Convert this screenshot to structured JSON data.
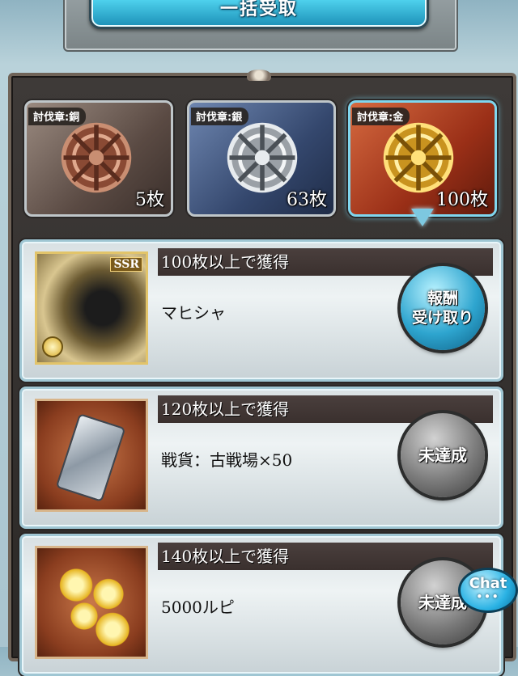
{
  "top_button": {
    "label": "一括受取"
  },
  "medals": [
    {
      "label": "討伐章:銅",
      "count": "5枚",
      "tier": "bronze"
    },
    {
      "label": "討伐章:銀",
      "count": "63枚",
      "tier": "silver"
    },
    {
      "label": "討伐章:金",
      "count": "100枚",
      "tier": "gold",
      "selected": true
    }
  ],
  "rewards": [
    {
      "requirement": "100枚以上で獲得",
      "item": "マヒシャ",
      "rarity_badge": "SSR",
      "button": "報酬\n受け取り",
      "state": "active",
      "icon": "weapon-icon"
    },
    {
      "requirement": "120枚以上で獲得",
      "item": "戦貨：古戦場×50",
      "button": "未達成",
      "state": "inactive",
      "icon": "war-currency-icon"
    },
    {
      "requirement": "140枚以上で獲得",
      "item": "5000ルピ",
      "button": "未達成",
      "state": "inactive",
      "icon": "rupie-coins-icon"
    }
  ],
  "chat": {
    "label": "Chat",
    "dots": "•••"
  },
  "colors": {
    "accent_blue": "#2ea5cf",
    "panel_dark": "#2c2927",
    "header_bar": "#3a302e"
  }
}
